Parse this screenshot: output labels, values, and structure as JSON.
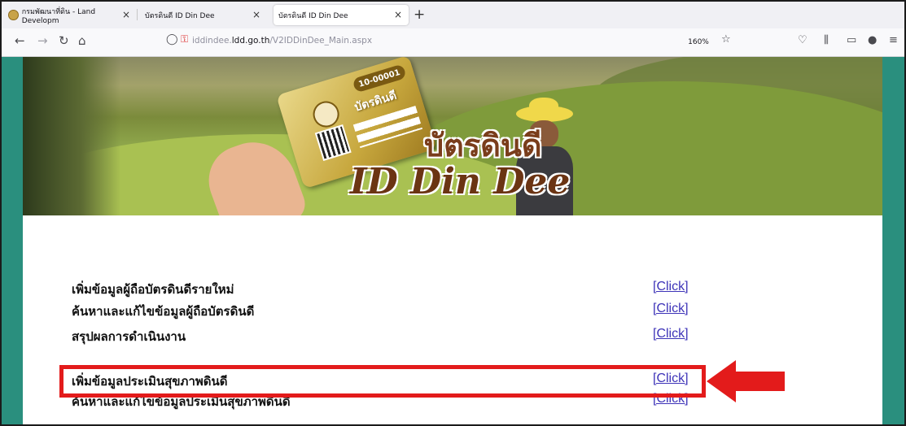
{
  "browser": {
    "tabs": [
      {
        "label": "กรมพัฒนาที่ดิน - Land Developm",
        "active": false
      },
      {
        "label": "บัตรดินดี ID Din Dee",
        "active": false
      },
      {
        "label": "บัตรดินดี ID Din Dee",
        "active": true
      }
    ],
    "url_prefix": "iddindee.",
    "url_domain": "ldd.go.th",
    "url_path": "/V2IDDinDee_Main.aspx",
    "zoom": "160%"
  },
  "banner": {
    "card_number": "10-00001",
    "card_title": "บัตรดินดี",
    "logo_thai": "บัตรดินดี",
    "logo_en": "ID Din Dee"
  },
  "menu": {
    "items": [
      {
        "label": "เพิ่มข้อมูลผู้ถือบัตรดินดีรายใหม่",
        "link": "[Click]"
      },
      {
        "label": "ค้นหาและแก้ไขข้อมูลผู้ถือบัตรดินดี",
        "link": "[Click]"
      },
      {
        "label": "สรุปผลการดำเนินงาน",
        "link": "[Click]"
      },
      {
        "label": "เพิ่มข้อมูลประเมินสุขภาพดินดี",
        "link": "[Click]"
      },
      {
        "label": "ค้นหาและแก้ไขข้อมูลประเมินสุขภาพดินดี",
        "link": "[Click]"
      }
    ]
  },
  "colors": {
    "highlight": "#e31b1b",
    "link": "#3d33b8",
    "page_border": "#2a8f7e"
  }
}
